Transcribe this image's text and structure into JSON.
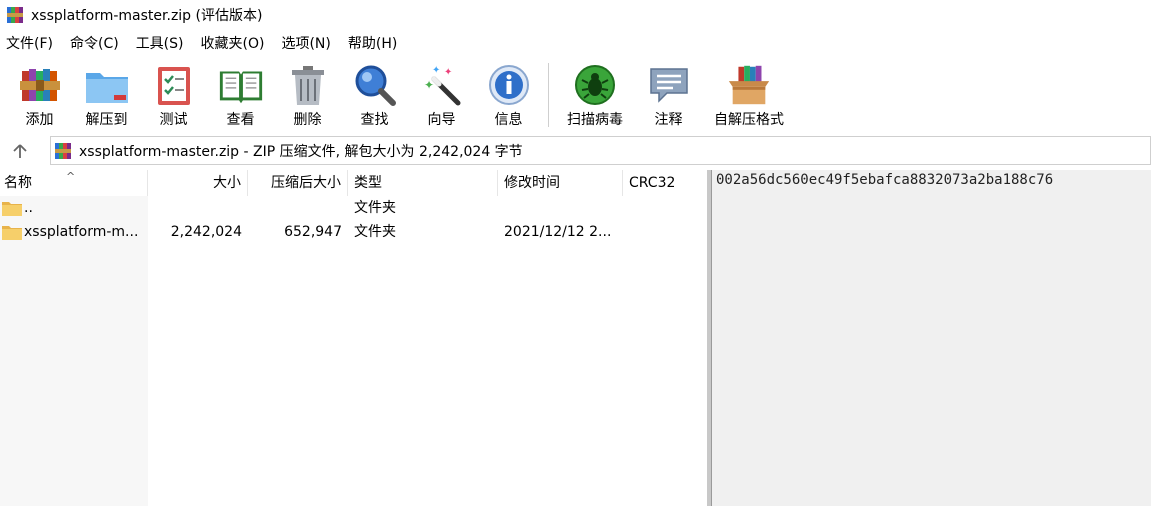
{
  "window": {
    "title": "xssplatform-master.zip (评估版本)"
  },
  "menu": [
    "文件(F)",
    "命令(C)",
    "工具(S)",
    "收藏夹(O)",
    "选项(N)",
    "帮助(H)"
  ],
  "toolbar": {
    "add": "添加",
    "extract_to": "解压到",
    "test": "测试",
    "view": "查看",
    "delete": "删除",
    "find": "查找",
    "wizard": "向导",
    "info": "信息",
    "virus_scan": "扫描病毒",
    "comment": "注释",
    "sfx": "自解压格式"
  },
  "address": {
    "text": "xssplatform-master.zip - ZIP 压缩文件, 解包大小为 2,242,024 字节"
  },
  "columns": {
    "name": "名称",
    "size": "大小",
    "packed": "压缩后大小",
    "type": "类型",
    "modified": "修改时间",
    "crc": "CRC32"
  },
  "rows": [
    {
      "name": "..",
      "size": "",
      "packed": "",
      "type": "文件夹",
      "modified": "",
      "crc": ""
    },
    {
      "name": "xssplatform-m...",
      "size": "2,242,024",
      "packed": "652,947",
      "type": "文件夹",
      "modified": "2021/12/12 2...",
      "crc": ""
    }
  ],
  "comment_text": "002a56dc560ec49f5ebafca8832073a2ba188c76"
}
